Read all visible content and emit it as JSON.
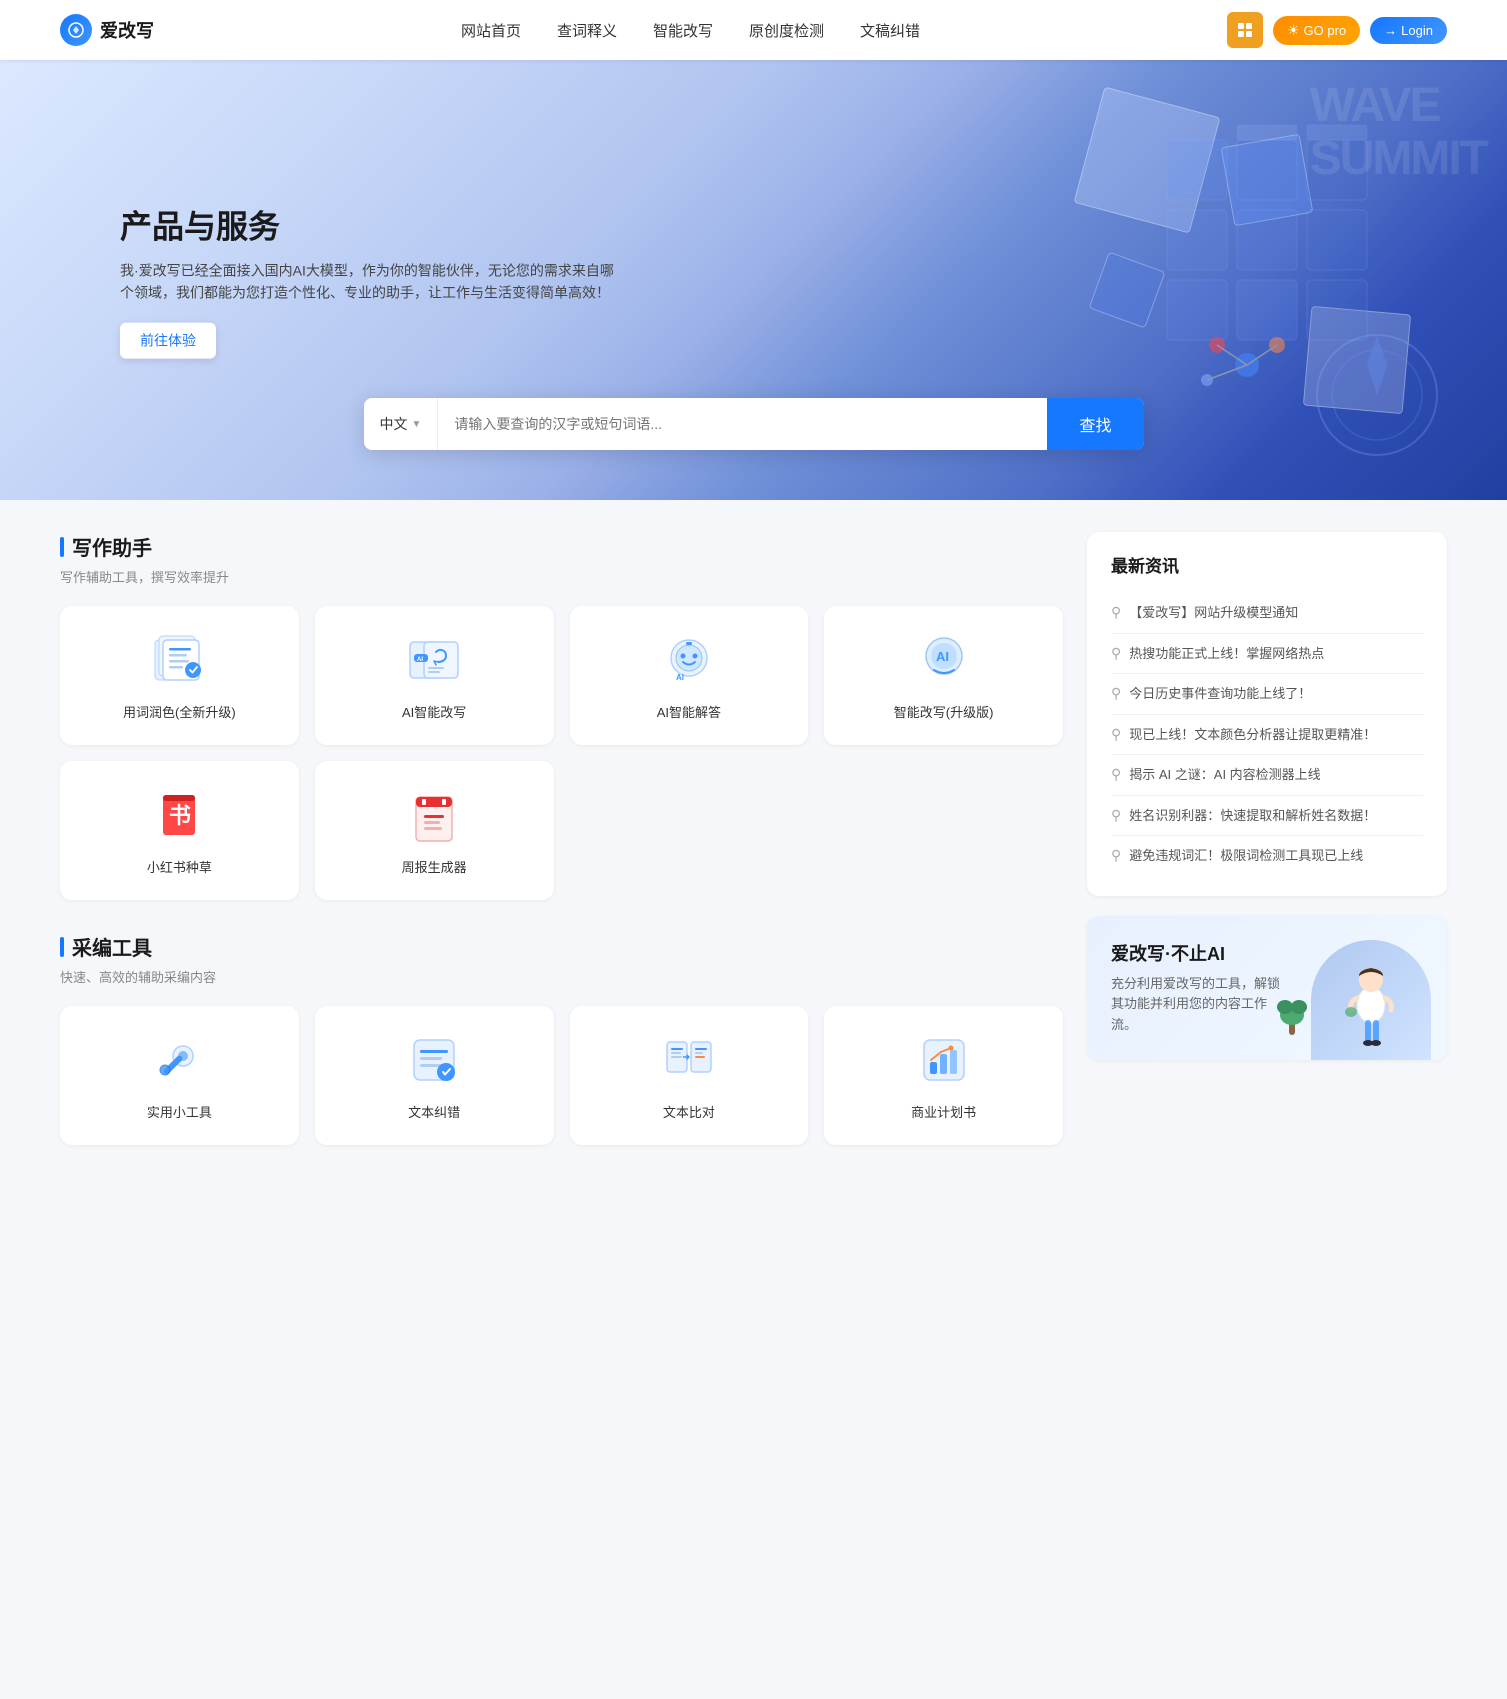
{
  "header": {
    "logo_icon": "✦",
    "logo_text": "爱改写",
    "nav": [
      {
        "label": "网站首页",
        "id": "nav-home"
      },
      {
        "label": "查词释义",
        "id": "nav-dict"
      },
      {
        "label": "智能改写",
        "id": "nav-rewrite"
      },
      {
        "label": "原创度检测",
        "id": "nav-original"
      },
      {
        "label": "文稿纠错",
        "id": "nav-correct"
      }
    ],
    "btn_grid_label": "apps",
    "btn_go_pro": "GO pro",
    "btn_login": "Login",
    "btn_login_icon": "→"
  },
  "hero": {
    "title": "产品与服务",
    "description": "我·爱改写已经全面接入国内AI大模型，作为你的智能伙伴，无论您的需求来自哪个领域，我们都能为您打造个性化、专业的助手，让工作与生活变得简单高效！",
    "btn_experience": "前往体验",
    "search": {
      "lang": "中文",
      "lang_arrow": "▼",
      "placeholder": "请输入要查询的汉字或短句词语...",
      "btn_label": "查找"
    }
  },
  "writing_section": {
    "title": "写作助手",
    "subtitle": "写作辅助工具，撰写效率提升",
    "tools": [
      {
        "id": "word-polish",
        "label": "用词润色(全新升级)",
        "icon_type": "writing"
      },
      {
        "id": "ai-rewrite",
        "label": "AI智能改写",
        "icon_type": "ai-rewrite"
      },
      {
        "id": "ai-answer",
        "label": "AI智能解答",
        "icon_type": "ai-answer"
      },
      {
        "id": "smart-rewrite-pro",
        "label": "智能改写(升级版)",
        "icon_type": "smart-rewrite"
      },
      {
        "id": "xiaohongshu",
        "label": "小红书种草",
        "icon_type": "book"
      },
      {
        "id": "weekly-report",
        "label": "周报生成器",
        "icon_type": "report"
      }
    ]
  },
  "caiji_section": {
    "title": "采编工具",
    "subtitle": "快速、高效的辅助采编内容",
    "tools": [
      {
        "id": "utility-tools",
        "label": "实用小工具",
        "icon_type": "wrench"
      },
      {
        "id": "text-correct",
        "label": "文本纠错",
        "icon_type": "text-correct"
      },
      {
        "id": "text-compare",
        "label": "文本比对",
        "icon_type": "text-compare"
      },
      {
        "id": "business-plan",
        "label": "商业计划书",
        "icon_type": "business-plan"
      }
    ]
  },
  "news_section": {
    "title": "最新资讯",
    "items": [
      {
        "text": "【爱改写】网站升级模型通知"
      },
      {
        "text": "热搜功能正式上线！掌握网络热点"
      },
      {
        "text": "今日历史事件查询功能上线了！"
      },
      {
        "text": "现已上线！文本颜色分析器让提取更精准！"
      },
      {
        "text": "揭示 AI 之谜：AI 内容检测器上线"
      },
      {
        "text": "姓名识别利器：快速提取和解析姓名数据！"
      },
      {
        "text": "避免违规词汇！极限词检测工具现已上线"
      }
    ]
  },
  "promo_section": {
    "title": "爱改写·不止AI",
    "description": "充分利用爱改写的工具，解锁其功能并利用您的内容工作流。"
  }
}
